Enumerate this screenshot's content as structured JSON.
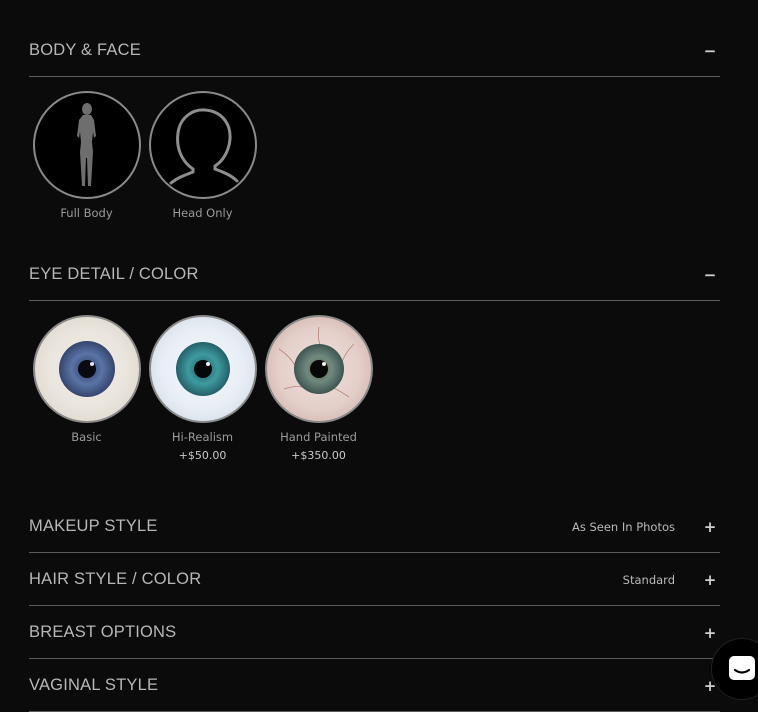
{
  "sections": [
    {
      "title": "BODY & FACE",
      "toggle": "−",
      "value": ""
    },
    {
      "title": "EYE DETAIL / COLOR",
      "toggle": "−",
      "value": ""
    },
    {
      "title": "MAKEUP STYLE",
      "toggle": "+",
      "value": "As Seen In Photos"
    },
    {
      "title": "HAIR STYLE / COLOR",
      "toggle": "+",
      "value": "Standard"
    },
    {
      "title": "BREAST OPTIONS",
      "toggle": "+",
      "value": ""
    },
    {
      "title": "VAGINAL STYLE",
      "toggle": "+",
      "value": ""
    }
  ],
  "body_options": [
    {
      "label": "Full Body",
      "icon": "female-silhouette-icon"
    },
    {
      "label": "Head Only",
      "icon": "head-outline-icon"
    }
  ],
  "eye_options": [
    {
      "label": "Basic",
      "price": ""
    },
    {
      "label": "Hi-Realism",
      "price": "+$50.00"
    },
    {
      "label": "Hand Painted",
      "price": "+$350.00"
    }
  ],
  "colors": {
    "background": "#0b0b0b",
    "divider": "#5a5a5a",
    "circle_border": "#8a8a8a"
  }
}
